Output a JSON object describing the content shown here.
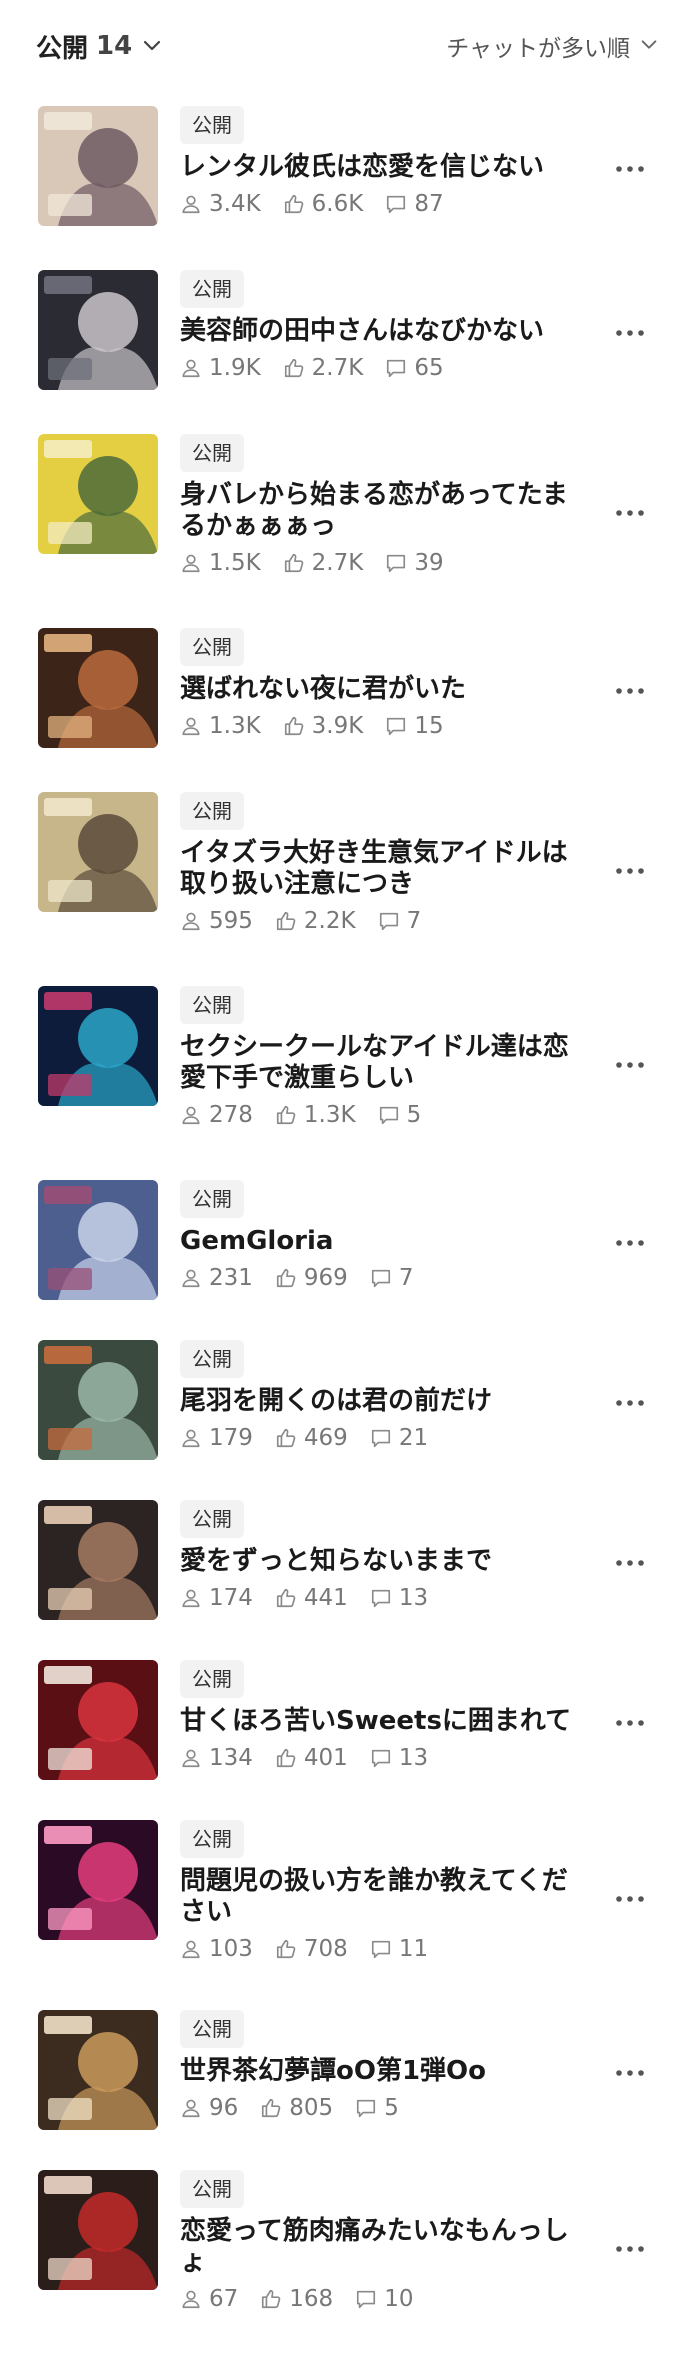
{
  "header": {
    "filter_label": "公開",
    "filter_count": "14",
    "sort_label": "チャットが多い順"
  },
  "colors": {
    "text": "#1a1a1a",
    "muted": "#777777",
    "badge_bg": "#f2f2f2"
  },
  "items": [
    {
      "badge": "公開",
      "title": "レンタル彼氏は恋愛を信じない",
      "followers": "3.4K",
      "likes": "6.6K",
      "comments": "87",
      "thumb_colors": [
        "#d9c7b8",
        "#6d5a63",
        "#f0e7d8"
      ]
    },
    {
      "badge": "公開",
      "title": "美容師の田中さんはなびかない",
      "followers": "1.9K",
      "likes": "2.7K",
      "comments": "65",
      "thumb_colors": [
        "#2b2c33",
        "#c9c4c9",
        "#6e6f7a"
      ]
    },
    {
      "badge": "公開",
      "title": "身バレから始まる恋があってたまるかぁぁぁっ",
      "followers": "1.5K",
      "likes": "2.7K",
      "comments": "39",
      "thumb_colors": [
        "#e4cf43",
        "#4c6b3a",
        "#f3ebc0"
      ]
    },
    {
      "badge": "公開",
      "title": "選ばれない夜に君がいた",
      "followers": "1.3K",
      "likes": "3.9K",
      "comments": "15",
      "thumb_colors": [
        "#3d2418",
        "#b86a3c",
        "#e2b27f"
      ]
    },
    {
      "badge": "公開",
      "title": "イタズラ大好き生意気アイドルは取り扱い注意につき",
      "followers": "595",
      "likes": "2.2K",
      "comments": "7",
      "thumb_colors": [
        "#c7b68a",
        "#5a4b3a",
        "#efe5c8"
      ]
    },
    {
      "badge": "公開",
      "title": "セクシークールなアイドル達は恋愛下手で激重らしい",
      "followers": "278",
      "likes": "1.3K",
      "comments": "5",
      "thumb_colors": [
        "#0e1c3b",
        "#2aa6c8",
        "#c13a6b"
      ]
    },
    {
      "badge": "公開",
      "title": "GemGloria",
      "followers": "231",
      "likes": "969",
      "comments": "7",
      "thumb_colors": [
        "#4c5f8f",
        "#c9d3ea",
        "#9a4f76"
      ]
    },
    {
      "badge": "公開",
      "title": "尾羽を開くのは君の前だけ",
      "followers": "179",
      "likes": "469",
      "comments": "21",
      "thumb_colors": [
        "#3a4a3f",
        "#9bb7a8",
        "#c66b3d"
      ]
    },
    {
      "badge": "公開",
      "title": "愛をずっと知らないままで",
      "followers": "174",
      "likes": "441",
      "comments": "13",
      "thumb_colors": [
        "#2b2422",
        "#a57b62",
        "#e7cdb5"
      ]
    },
    {
      "badge": "公開",
      "title": "甘くほろ苦いSweetsに囲まれて",
      "followers": "134",
      "likes": "401",
      "comments": "13",
      "thumb_colors": [
        "#5a0f15",
        "#d8333d",
        "#f1e7dd"
      ]
    },
    {
      "badge": "公開",
      "title": "問題児の扱い方を誰か教えてください",
      "followers": "103",
      "likes": "708",
      "comments": "11",
      "thumb_colors": [
        "#2a0a24",
        "#e53d7d",
        "#ff9cc5"
      ]
    },
    {
      "badge": "公開",
      "title": "世界茶幻夢譚oO第1弾Oo",
      "followers": "96",
      "likes": "805",
      "comments": "5",
      "thumb_colors": [
        "#3c2b1f",
        "#c99a5c",
        "#efe0c5"
      ]
    },
    {
      "badge": "公開",
      "title": "恋愛って筋肉痛みたいなもんっしょ",
      "followers": "67",
      "likes": "168",
      "comments": "10",
      "thumb_colors": [
        "#2a1d1a",
        "#c32a2a",
        "#f0d9c9"
      ]
    }
  ]
}
